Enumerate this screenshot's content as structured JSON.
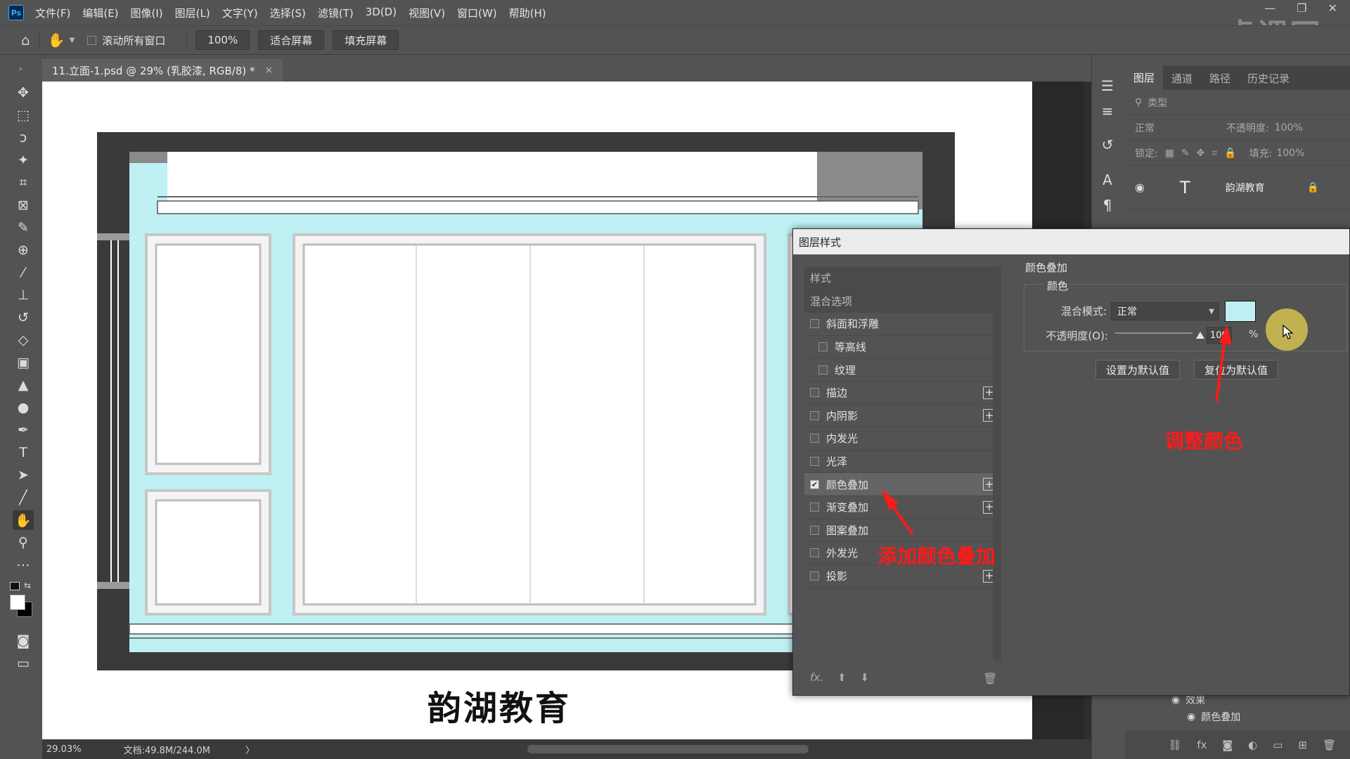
{
  "app": {
    "logo": "Ps",
    "menu": [
      "文件(F)",
      "编辑(E)",
      "图像(I)",
      "图层(L)",
      "文字(Y)",
      "选择(S)",
      "滤镜(T)",
      "3D(D)",
      "视图(V)",
      "窗口(W)",
      "帮助(H)"
    ],
    "window_controls": [
      "—",
      "❐",
      "✕"
    ],
    "watermark": "虎课网"
  },
  "options": {
    "scroll_all_label": "滚动所有窗口",
    "zoom_value": "100%",
    "fit_screen": "适合屏幕",
    "fill_screen": "填充屏幕"
  },
  "document": {
    "tab_title": "11.立面-1.psd @ 29% (乳胶漆, RGB/8) *",
    "close": "×",
    "canvas_text": "韵湖教育",
    "wall_color": "#bff0f4"
  },
  "status": {
    "zoom": "29.03%",
    "doc_size": "文档:49.8M/244.0M",
    "arrow": "〉"
  },
  "layers_panel": {
    "tabs": [
      "图层",
      "通道",
      "路径",
      "历史记录"
    ],
    "active_tab": "图层",
    "filter_label": "类型",
    "blend_mode": "正常",
    "opacity_label": "不透明度:",
    "opacity_value": "100%",
    "lock_label": "锁定:",
    "fill_label": "填充:",
    "fill_value": "100%",
    "layer_name": "韵湖教育",
    "effects_label": "效果",
    "effect_item": "颜色叠加"
  },
  "dialog": {
    "title": "图层样式",
    "styles_header": "样式",
    "blend_options": "混合选项",
    "effects": [
      {
        "label": "斜面和浮雕",
        "checked": false,
        "sub": false,
        "plus": false
      },
      {
        "label": "等高线",
        "checked": false,
        "sub": true,
        "plus": false
      },
      {
        "label": "纹理",
        "checked": false,
        "sub": true,
        "plus": false
      },
      {
        "label": "描边",
        "checked": false,
        "sub": false,
        "plus": true
      },
      {
        "label": "内阴影",
        "checked": false,
        "sub": false,
        "plus": true
      },
      {
        "label": "内发光",
        "checked": false,
        "sub": false,
        "plus": false
      },
      {
        "label": "光泽",
        "checked": false,
        "sub": false,
        "plus": false
      },
      {
        "label": "颜色叠加",
        "checked": true,
        "sub": false,
        "plus": true
      },
      {
        "label": "渐变叠加",
        "checked": false,
        "sub": false,
        "plus": true
      },
      {
        "label": "图案叠加",
        "checked": false,
        "sub": false,
        "plus": false
      },
      {
        "label": "外发光",
        "checked": false,
        "sub": false,
        "plus": false
      },
      {
        "label": "投影",
        "checked": false,
        "sub": false,
        "plus": true
      }
    ],
    "footer_fx": "fx.",
    "section_title": "颜色叠加",
    "group_title": "颜色",
    "blend_mode_label": "混合模式:",
    "blend_mode_value": "正常",
    "overlay_color": "#bfeff4",
    "opacity_label": "不透明度(O):",
    "opacity_value": "100",
    "opacity_unit": "%",
    "opacity_level": 1.0,
    "set_default": "设置为默认值",
    "reset_default": "复位为默认值"
  },
  "annotations": {
    "add_overlay": "添加颜色叠加",
    "adjust_color": "调整颜色",
    "color": "#ff1a1a"
  }
}
